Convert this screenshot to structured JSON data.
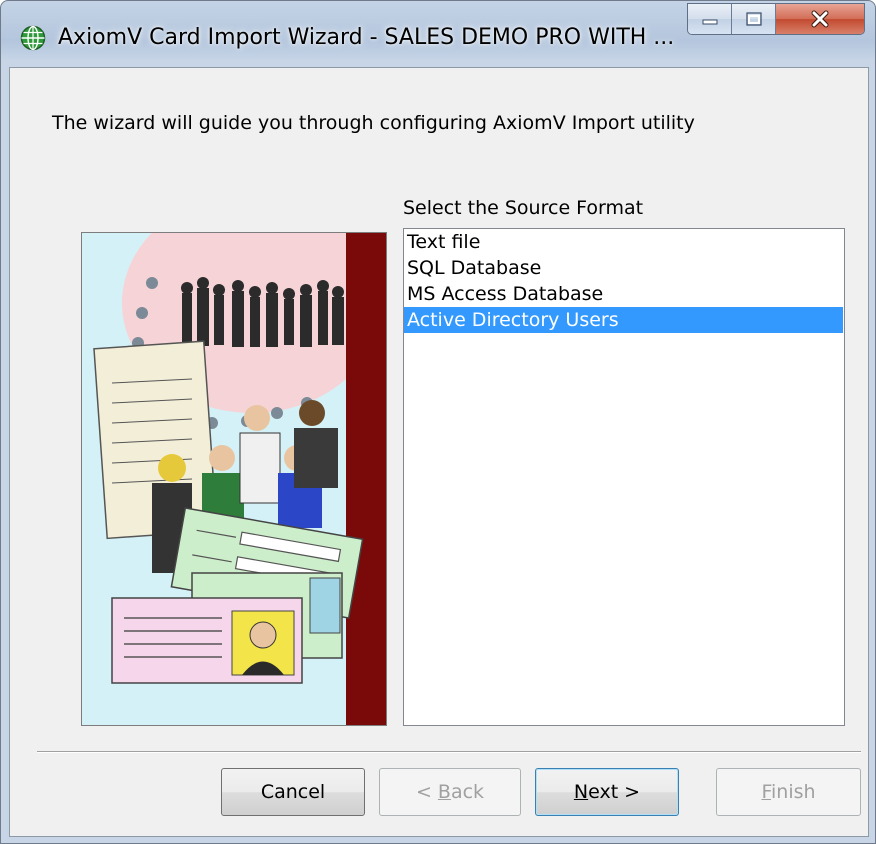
{
  "window": {
    "title": "AxiomV  Card Import Wizard - SALES DEMO PRO WITH ..."
  },
  "wizard": {
    "intro_text": "The wizard will guide you through configuring AxiomV Import utility",
    "source_label": "Select the Source Format",
    "source_formats": [
      "Text file",
      "SQL Database",
      "MS Access Database",
      "Active Directory Users"
    ],
    "selected_format": "Active Directory Users"
  },
  "buttons": {
    "cancel": "Cancel",
    "back_prefix": "< ",
    "back_key": "B",
    "back_rest": "ack",
    "next_key": "N",
    "next_rest": "ext >",
    "finish_key": "F",
    "finish_rest": "inish"
  },
  "colors": {
    "selection": "#3399ff",
    "dialog_bg": "#f0f0f0",
    "close_button": "#c14a30",
    "illustration_stripe": "#7a0a0a"
  }
}
